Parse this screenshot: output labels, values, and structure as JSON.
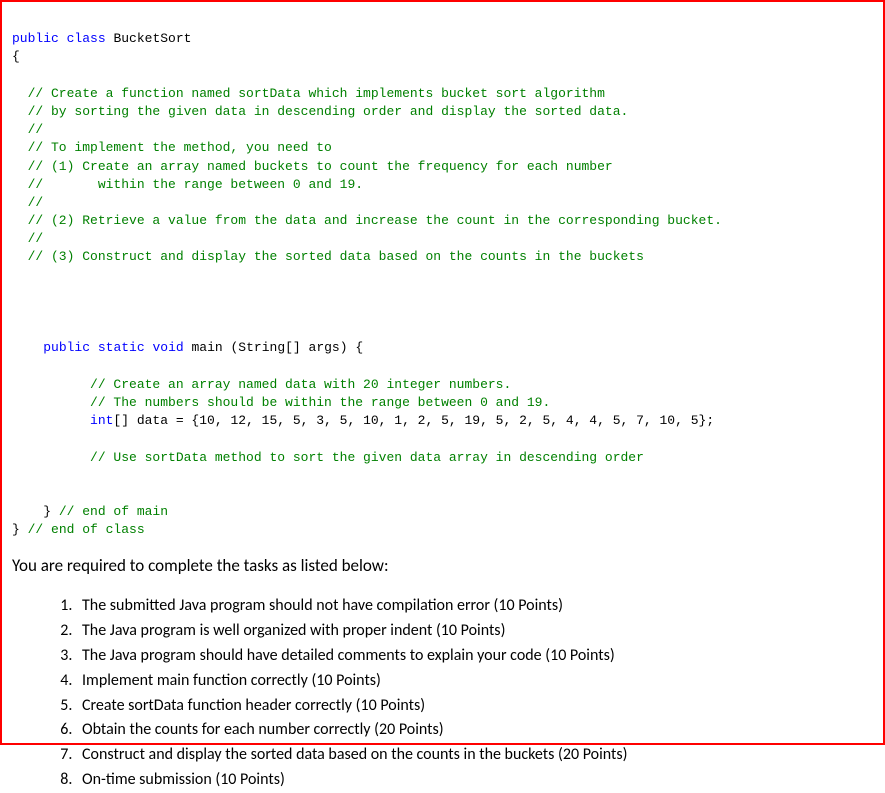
{
  "code": {
    "line1_kw1": "public",
    "line1_kw2": "class",
    "line1_name": "BucketSort",
    "line2_brace": "{",
    "comment_block1_l1": "  // Create a function named sortData which implements bucket sort algorithm",
    "comment_block1_l2": "  // by sorting the given data in descending order and display the sorted data.",
    "comment_block1_l3": "  //",
    "comment_block1_l4": "  // To implement the method, you need to",
    "comment_block1_l5": "  // (1) Create an array named buckets to count the frequency for each number",
    "comment_block1_l6": "  //       within the range between 0 and 19.",
    "comment_block1_l7": "  //",
    "comment_block1_l8": "  // (2) Retrieve a value from the data and increase the count in the corresponding bucket.",
    "comment_block1_l9": "  //",
    "comment_block1_l10": "  // (3) Construct and display the sorted data based on the counts in the buckets",
    "main_indent": "    ",
    "main_kw1": "public",
    "main_kw2": "static",
    "main_kw3": "void",
    "main_name": "main (String[] args) {",
    "main_comment1": "          // Create an array named data with 20 integer numbers.",
    "main_comment2": "          // The numbers should be within the range between 0 and 19.",
    "main_decl_indent": "          ",
    "main_decl_kw": "int",
    "main_decl_text": "[] data = {10, 12, 15, 5, 3, 5, 10, 1, 2, 5, 19, 5, 2, 5, 4, 4, 5, 7, 10, 5};",
    "main_comment3": "          // Use sortData method to sort the given data array in descending order",
    "main_close": "    } ",
    "main_close_comment": "// end of main",
    "class_close": "} ",
    "class_close_comment": "// end of class"
  },
  "instructions": {
    "heading": "You are required to complete the tasks as listed below:",
    "items": [
      "The submitted Java program should not have compilation error (10 Points)",
      "The Java program is well organized with proper indent (10 Points)",
      "The Java program should have detailed comments to explain your code (10 Points)",
      "Implement main function correctly (10 Points)",
      "Create sortData function header correctly (10 Points)",
      "Obtain the counts for each number correctly (20 Points)",
      "Construct and display the sorted data based on the counts in the buckets (20 Points)",
      "On-time submission (10 Points)"
    ]
  }
}
